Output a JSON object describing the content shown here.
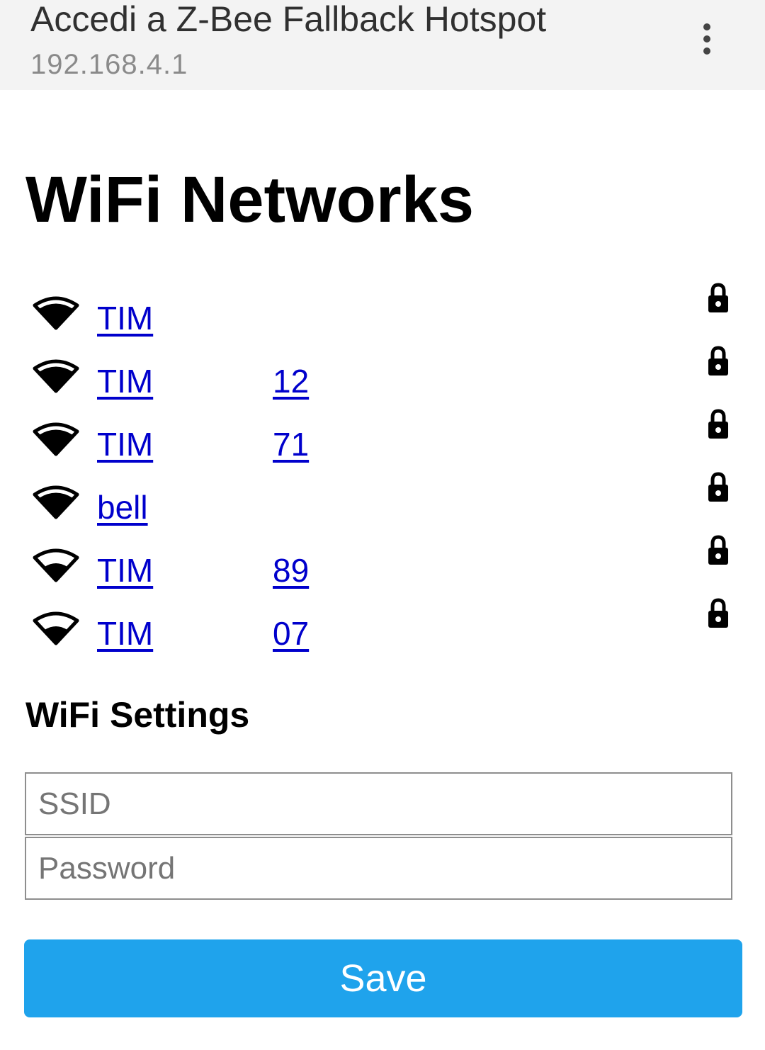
{
  "header": {
    "title": "Accedi a Z-Bee Fallback Hotspot",
    "url": "192.168.4.1",
    "menu_icon": "more-vert-icon"
  },
  "main": {
    "title": "WiFi Networks",
    "networks": [
      {
        "name": "TIM",
        "suffix": "",
        "signal_bars": 4,
        "secured": true
      },
      {
        "name": "TIM",
        "suffix": "12",
        "signal_bars": 4,
        "secured": true
      },
      {
        "name": "TIM",
        "suffix": "71",
        "signal_bars": 4,
        "secured": true
      },
      {
        "name": "bell",
        "suffix": "",
        "signal_bars": 4,
        "secured": true
      },
      {
        "name": "TIM",
        "suffix": "89",
        "signal_bars": 3,
        "secured": true
      },
      {
        "name": "TIM",
        "suffix": "07",
        "signal_bars": 3,
        "secured": true
      }
    ],
    "settings_title": "WiFi Settings",
    "ssid_placeholder": "SSID",
    "password_placeholder": "Password",
    "save_label": "Save"
  },
  "colors": {
    "topbar_bg": "#f3f3f3",
    "link": "#0000cc",
    "button_bg": "#1fa3ec",
    "button_text": "#ffffff"
  }
}
